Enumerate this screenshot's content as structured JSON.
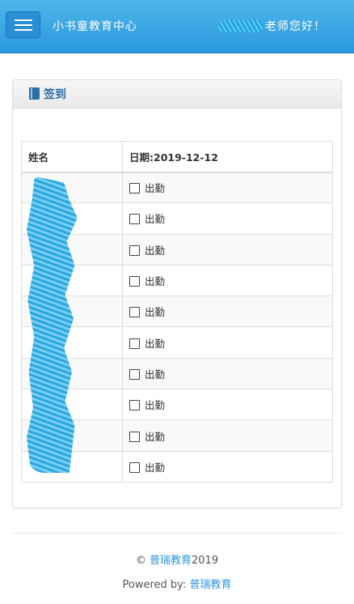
{
  "header": {
    "brand": "小书童教育中心",
    "greeting_suffix": "老师您好！"
  },
  "panel": {
    "title": "签到"
  },
  "table": {
    "col_name": "姓名",
    "col_date": "日期:2019-12-12",
    "checkbox_label": "出勤",
    "row_count": 10
  },
  "footer": {
    "copyright_symbol": "©",
    "copyright_link": "普瑞教育",
    "copyright_year": "2019",
    "powered_prefix": "Powered by:",
    "powered_link": "普瑞教育"
  }
}
